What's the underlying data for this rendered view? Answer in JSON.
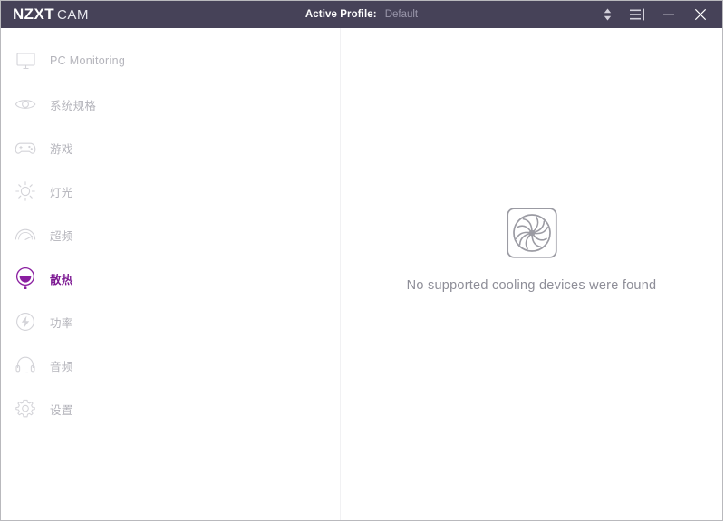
{
  "window": {
    "logo_primary": "NZXT",
    "logo_secondary": "CAM",
    "colors": {
      "titlebar_bg": "#464258",
      "accent_active": "#7d1a93",
      "nav_idle_text": "#b4b4bb",
      "empty_text": "#8e8e98"
    }
  },
  "titlebar": {
    "profile_label": "Active Profile:",
    "profile_value": "Default",
    "profile_selector_icon": "updown-chevron-icon",
    "menu_icon": "list-menu-icon",
    "minimize_icon": "minimize-icon",
    "close_icon": "close-icon"
  },
  "sidebar": {
    "items": [
      {
        "label": "PC Monitoring",
        "icon": "monitor-icon",
        "active": false
      },
      {
        "label": "系统规格",
        "icon": "eye-icon",
        "active": false
      },
      {
        "label": "游戏",
        "icon": "gamepad-icon",
        "active": false
      },
      {
        "label": "灯光",
        "icon": "sun-icon",
        "active": false
      },
      {
        "label": "超频",
        "icon": "speedometer-icon",
        "active": false
      },
      {
        "label": "散热",
        "icon": "cooling-gauge-icon",
        "active": true
      },
      {
        "label": "功率",
        "icon": "power-bolt-icon",
        "active": false
      },
      {
        "label": "音频",
        "icon": "headset-icon",
        "active": false
      },
      {
        "label": "设置",
        "icon": "gear-icon",
        "active": false
      }
    ]
  },
  "main": {
    "empty_icon": "fan-icon",
    "empty_message": "No supported cooling devices were found"
  }
}
